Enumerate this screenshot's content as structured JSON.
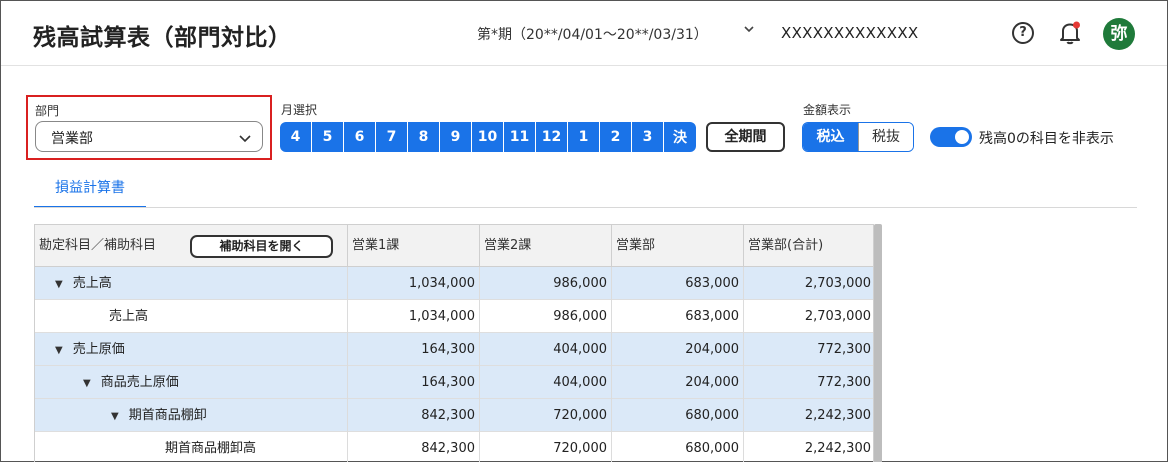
{
  "header": {
    "title": "残高試算表（部門対比）",
    "period": "第*期（20**/04/01〜20**/03/31）",
    "company": "XXXXXXXXXXXXX",
    "avatar_text": "弥"
  },
  "filters": {
    "department_label": "部門",
    "department_value": "営業部",
    "month_label": "月選択",
    "months": [
      "4",
      "5",
      "6",
      "7",
      "8",
      "9",
      "10",
      "11",
      "12",
      "1",
      "2",
      "3",
      "決"
    ],
    "all_period": "全期間",
    "amount_label": "金額表示",
    "amount_options": [
      "税込",
      "税抜"
    ],
    "hide_zero_label": "残高0の科目を非表示"
  },
  "tabs": [
    "損益計算書"
  ],
  "table": {
    "header_label": "勘定科目／補助科目",
    "open_button": "補助科目を開く",
    "columns": [
      "営業1課",
      "営業2課",
      "営業部",
      "営業部(合計)"
    ],
    "rows": [
      {
        "label": "売上高",
        "group": true,
        "level": 0,
        "values": [
          "1,034,000",
          "986,000",
          "683,000",
          "2,703,000"
        ]
      },
      {
        "label": "売上高",
        "group": false,
        "level": 1,
        "values": [
          "1,034,000",
          "986,000",
          "683,000",
          "2,703,000"
        ]
      },
      {
        "label": "売上原価",
        "group": true,
        "level": 0,
        "values": [
          "164,300",
          "404,000",
          "204,000",
          "772,300"
        ]
      },
      {
        "label": "商品売上原価",
        "group": true,
        "level": 1,
        "values": [
          "164,300",
          "404,000",
          "204,000",
          "772,300"
        ]
      },
      {
        "label": "期首商品棚卸",
        "group": true,
        "level": 2,
        "values": [
          "842,300",
          "720,000",
          "680,000",
          "2,242,300"
        ]
      },
      {
        "label": "期首商品棚卸高",
        "group": false,
        "level": 3,
        "values": [
          "842,300",
          "720,000",
          "680,000",
          "2,242,300"
        ]
      }
    ]
  },
  "colors": {
    "accent": "#1a73e8",
    "highlight_border": "#d92020",
    "avatar_bg": "#1f7a3a",
    "group_row_bg": "#dbe9f8"
  }
}
